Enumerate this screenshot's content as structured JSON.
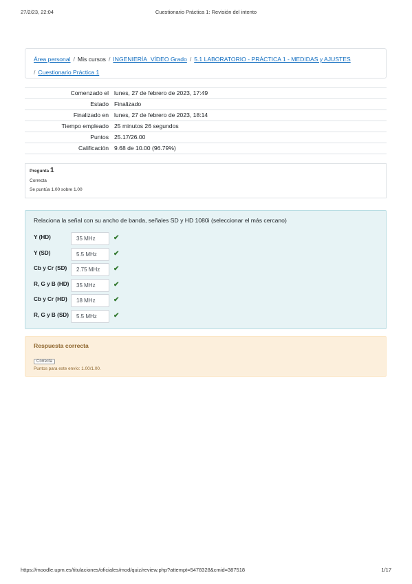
{
  "print_header": {
    "date": "27/2/23, 22:04",
    "title": "Cuestionario Práctica 1: Revisión del intento"
  },
  "breadcrumb": {
    "items": [
      {
        "label": "Área personal",
        "link": true
      },
      {
        "label": "Mis cursos",
        "link": false
      },
      {
        "label": "INGENIERÍA_VÍDEO Grado",
        "link": true
      },
      {
        "label": "5.1 LABORATORIO - PRÁCTICA 1 - MEDIDAS y AJUSTES",
        "link": true
      },
      {
        "label": "Cuestionario Práctica 1",
        "link": true
      }
    ],
    "separator": "/"
  },
  "summary": [
    {
      "label": "Comenzado el",
      "value": "lunes, 27 de febrero de 2023, 17:49"
    },
    {
      "label": "Estado",
      "value": "Finalizado"
    },
    {
      "label": "Finalizado en",
      "value": "lunes, 27 de febrero de 2023, 18:14"
    },
    {
      "label": "Tiempo empleado",
      "value": "25 minutos 26 segundos"
    },
    {
      "label": "Puntos",
      "value": "25.17/26.00"
    },
    {
      "label": "Calificación",
      "value": "9.68 de 10.00 (96.79%)"
    }
  ],
  "question_info": {
    "prefix": "Pregunta",
    "number": "1",
    "state": "Correcta",
    "grade": "Se puntúa 1.00 sobre 1.00"
  },
  "question": {
    "text": "Relaciona la señal con su ancho de banda, señales SD y HD 1080i (seleccionar el más cercano)",
    "rows": [
      {
        "label": "Y (HD)",
        "answer": "35 MHz",
        "status": "✔"
      },
      {
        "label": "Y (SD)",
        "answer": "5.5 MHz",
        "status": "✔"
      },
      {
        "label": "Cb y Cr (SD)",
        "answer": "2.75 MHz",
        "status": "✔"
      },
      {
        "label": "R, G y B (HD)",
        "answer": "35 MHz",
        "status": "✔"
      },
      {
        "label": "Cb y Cr (HD)",
        "answer": "18 MHz",
        "status": "✔"
      },
      {
        "label": "R, G y B (SD)",
        "answer": "5.5 MHz",
        "status": "✔"
      }
    ],
    "correct_color": "#357a32"
  },
  "feedback": {
    "title": "Respuesta correcta",
    "badge": "Correcta",
    "points": "Puntos para este envío: 1.00/1.00."
  },
  "print_footer": {
    "url": "https://moodle.upm.es/titulaciones/oficiales/mod/quiz/review.php?attempt=5478328&cmid=387518",
    "page": "1/17"
  }
}
